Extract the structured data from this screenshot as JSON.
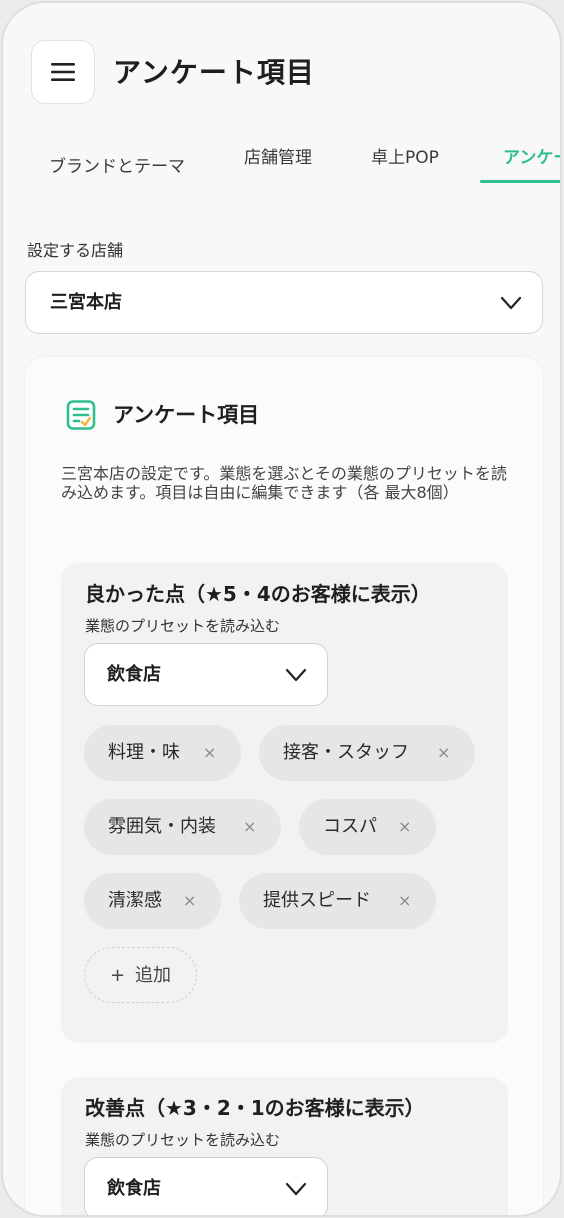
{
  "header": {
    "title": "アンケート項目"
  },
  "tabs": [
    {
      "label": "ブランドとテーマ"
    },
    {
      "label": "店舗管理"
    },
    {
      "label": "卓上POP"
    },
    {
      "label": "アンケー"
    }
  ],
  "store": {
    "label": "設定する店舗",
    "selected": "三宮本店"
  },
  "panel": {
    "title": "アンケート項目",
    "description": "三宮本店の設定です。業態を選ぶとその業態のプリセットを読み込めます。項目は自由に編集できます（各 最大8個）"
  },
  "good_section": {
    "title": "良かった点（★5・4のお客様に表示）",
    "preset_label": "業態のプリセットを読み込む",
    "preset_value": "飲食店",
    "chips": [
      "料理・味",
      "接客・スタッフ",
      "雰囲気・内装",
      "コスパ",
      "清潔感",
      "提供スピード"
    ],
    "remove_glyph": "×",
    "add_plus": "+",
    "add_label": "追加"
  },
  "improve_section": {
    "title": "改善点（★3・2・1のお客様に表示）",
    "preset_label": "業態のプリセットを読み込む",
    "preset_value": "飲食店"
  },
  "colors": {
    "accent": "#2fbf8a",
    "chip_bg": "#e6e6e6",
    "section_bg": "#f2f2f2"
  }
}
